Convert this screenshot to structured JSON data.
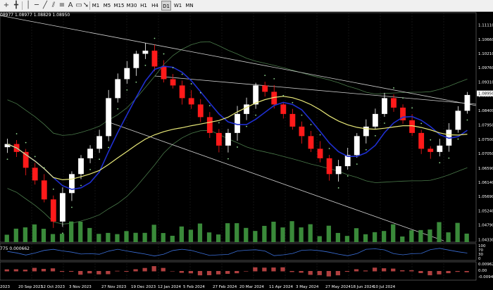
{
  "colors": {
    "background": "#000000",
    "bull": "#ffffff",
    "bear": "#ff1a1a",
    "ma_fast": "#1f2fd0",
    "ma_slow": "#e8e878",
    "bands": "#4a7a4a",
    "psar": "#8fd88f",
    "trendline": "#d0d0d0",
    "volume": "#3a8a3a",
    "rsi": "#3b6fd8",
    "macd": "#b04040",
    "price_tag": "#ffffff"
  },
  "toolbar": {
    "timeframes": [
      "M1",
      "M5",
      "M15",
      "M30",
      "H1",
      "H4",
      "D1",
      "W1",
      "MN"
    ],
    "active_timeframe": "D1",
    "icons": [
      "add-icon",
      "crosshair-icon",
      "vertical-line-icon",
      "horizontal-line-icon",
      "trendline-icon",
      "channel-icon",
      "fibonacci-icon",
      "text-icon",
      "label-icon",
      "arrow-icon"
    ]
  },
  "ohlc_readout": "08977 1.08977 1.08829 1.08950",
  "indicator_readout": "775 0.000662",
  "chart_data": {
    "type": "candlestick",
    "price_axis": [
      "1.11110",
      "1.10660",
      "1.10210",
      "1.09760",
      "1.09310",
      "1.08890",
      "1.08409",
      "1.07950",
      "1.07500",
      "1.07050",
      "1.06590",
      "1.06140",
      "1.05690",
      "1.05240",
      "1.04790",
      "1.04330"
    ],
    "price_axis_ticks": [
      1.1111,
      1.1066,
      1.1021,
      1.0976,
      1.0931,
      1.0889,
      1.08409,
      1.0795,
      1.075,
      1.0705,
      1.0659,
      1.0614,
      1.0569,
      1.0524,
      1.0479,
      1.0433
    ],
    "current_price": "1.08950",
    "ylim": [
      1.0425,
      1.115
    ],
    "dates": [
      "2023",
      "20 Sep 2023",
      "12 Oct 2023",
      "3 Nov 2023",
      "27 Nov 2023",
      "19 Dec 2023",
      "12 Jan 2024",
      "5 Feb 2024",
      "27 Feb 2024",
      "20 Mar 2024",
      "11 Apr 2024",
      "3 May 2024",
      "27 May 2024",
      "18 Jun 2024",
      "10 Jul 2024"
    ],
    "closes": [
      1.0735,
      1.071,
      1.066,
      1.062,
      1.056,
      1.049,
      1.058,
      1.064,
      1.069,
      1.072,
      1.076,
      1.088,
      1.094,
      1.0975,
      1.102,
      1.103,
      1.098,
      1.094,
      1.092,
      1.088,
      1.086,
      1.082,
      1.077,
      1.073,
      1.077,
      1.083,
      1.086,
      1.092,
      1.09,
      1.086,
      1.083,
      1.079,
      1.076,
      1.072,
      1.069,
      1.064,
      1.0665,
      1.07,
      1.076,
      1.079,
      1.083,
      1.088,
      1.085,
      1.081,
      1.077,
      1.072,
      1.071,
      1.073,
      1.078,
      1.084,
      1.089
    ],
    "rsi_levels": [
      "100",
      "70",
      "30",
      "0"
    ],
    "macd_levels": [
      "0.00962",
      "0.00",
      "-0.00942"
    ]
  }
}
